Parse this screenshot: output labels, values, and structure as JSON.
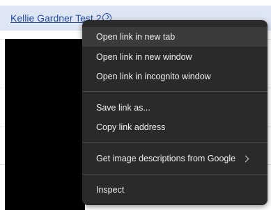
{
  "record": {
    "title": "Kellie Gardner Test 2"
  },
  "context_menu": {
    "items": [
      {
        "label": "Open link in new tab"
      },
      {
        "label": "Open link in new window"
      },
      {
        "label": "Open link in incognito window"
      },
      {
        "label": "Save link as..."
      },
      {
        "label": "Copy link address"
      },
      {
        "label": "Get image descriptions from Google"
      },
      {
        "label": "Inspect"
      }
    ]
  },
  "colors": {
    "menu_background": "#2a2a2a",
    "link": "#1f4aa8"
  }
}
